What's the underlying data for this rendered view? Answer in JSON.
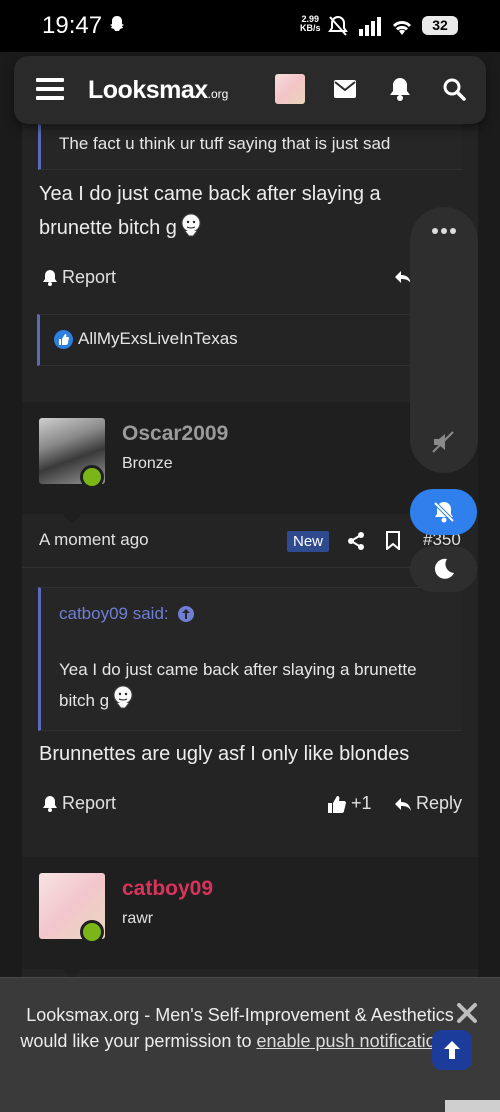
{
  "status_bar": {
    "time": "19:47",
    "net_speed_value": "2.99",
    "net_speed_unit": "KB/s",
    "battery": "32"
  },
  "nav": {
    "logo_main": "Looksmax",
    "logo_suffix": ".org"
  },
  "post1": {
    "quote_text": "The fact u think ur tuff saying that is just sad",
    "message_line1": "Yea I do just came back after slaying a",
    "message_line2": "brunette bitch g",
    "report_label": "Report",
    "reaction_user": "AllMyExsLiveInTexas"
  },
  "post2": {
    "username": "Oscar2009",
    "user_title": "Bronze",
    "time": "A moment ago",
    "new_badge": "New",
    "post_number": "#350",
    "quote_author": "catboy09 said:",
    "quote_line1": "Yea I do just came back after slaying a brunette",
    "quote_line2": "bitch g",
    "message": "Brunnettes are ugly asf I only like blondes",
    "report_label": "Report",
    "like_count": "+1",
    "reply_label": "Reply"
  },
  "post3": {
    "username": "catboy09",
    "user_title": "rawr"
  },
  "push": {
    "text_before": "Looksmax.org - Men's Self-Improvement & Aesthetics would like your permission to ",
    "link_text": "enable push notifications",
    "text_after": "."
  },
  "colors": {
    "accent_blue": "#2f80ed",
    "quote_border": "#5a6bb8",
    "username_grey": "#9a9a9a",
    "username_pink": "#d8335a",
    "online_green": "#7cb518"
  }
}
